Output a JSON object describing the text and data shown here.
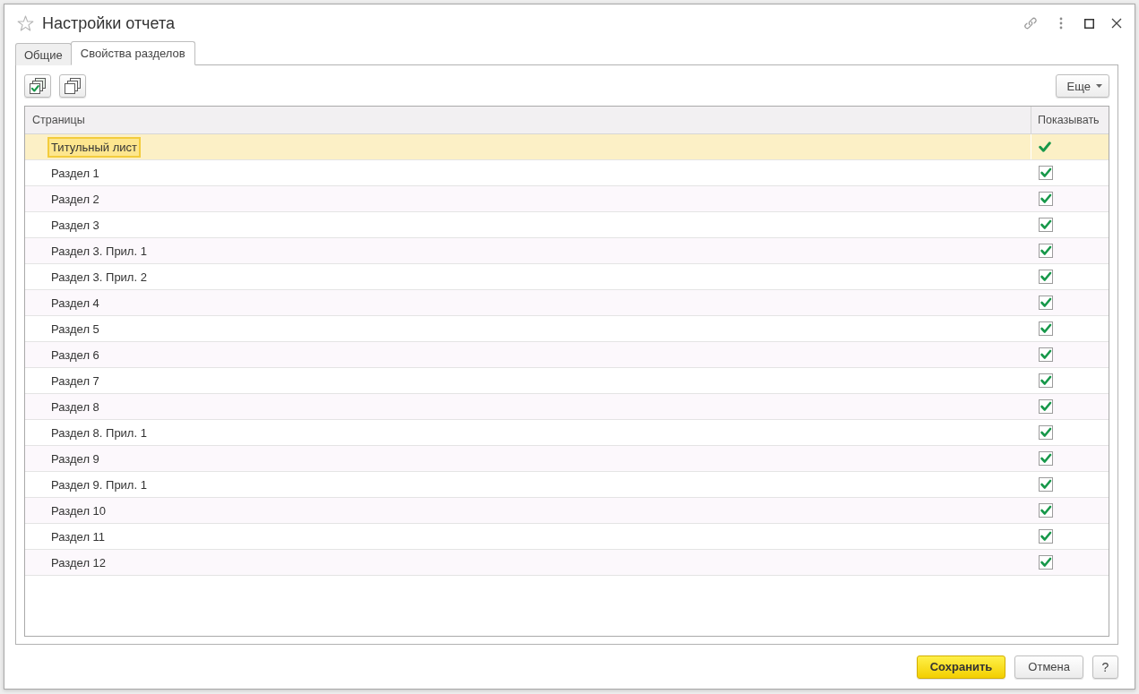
{
  "window": {
    "title": "Настройки отчета",
    "favorite": false
  },
  "tabs": [
    {
      "label": "Общие",
      "selected": false
    },
    {
      "label": "Свойства разделов",
      "selected": true
    }
  ],
  "toolbar": {
    "more_button": "Еще"
  },
  "table": {
    "columns": [
      "Страницы",
      "Показывать"
    ],
    "rows": [
      {
        "page": "Титульный лист",
        "show": true,
        "selected": true
      },
      {
        "page": "Раздел 1",
        "show": true,
        "selected": false
      },
      {
        "page": "Раздел 2",
        "show": true,
        "selected": false
      },
      {
        "page": "Раздел 3",
        "show": true,
        "selected": false
      },
      {
        "page": "Раздел 3. Прил. 1",
        "show": true,
        "selected": false
      },
      {
        "page": "Раздел 3. Прил. 2",
        "show": true,
        "selected": false
      },
      {
        "page": "Раздел 4",
        "show": true,
        "selected": false
      },
      {
        "page": "Раздел 5",
        "show": true,
        "selected": false
      },
      {
        "page": "Раздел 6",
        "show": true,
        "selected": false
      },
      {
        "page": "Раздел 7",
        "show": true,
        "selected": false
      },
      {
        "page": "Раздел 8",
        "show": true,
        "selected": false
      },
      {
        "page": "Раздел 8. Прил. 1",
        "show": true,
        "selected": false
      },
      {
        "page": "Раздел 9",
        "show": true,
        "selected": false
      },
      {
        "page": "Раздел 9. Прил. 1",
        "show": true,
        "selected": false
      },
      {
        "page": "Раздел 10",
        "show": true,
        "selected": false
      },
      {
        "page": "Раздел 11",
        "show": true,
        "selected": false
      },
      {
        "page": "Раздел 12",
        "show": true,
        "selected": false
      }
    ]
  },
  "buttons": [
    {
      "label": "Сохранить",
      "kind": "primary"
    },
    {
      "label": "Отмена",
      "kind": "default"
    },
    {
      "label": "?",
      "kind": "help"
    }
  ]
}
